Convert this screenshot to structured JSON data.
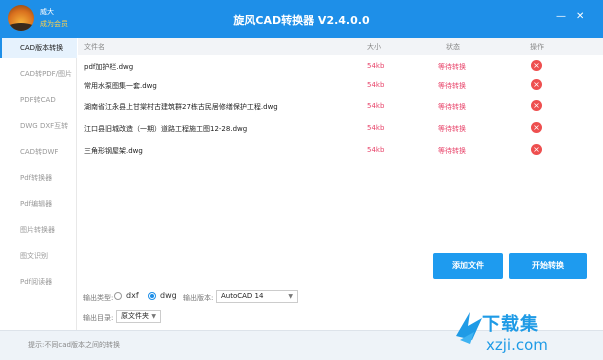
{
  "header": {
    "username": "威大",
    "member_label": "成为会员",
    "title": "旋风CAD转换器 V2.4.0.0",
    "minimize_glyph": "—",
    "close_glyph": "✕"
  },
  "sidebar": {
    "items": [
      {
        "label": "CAD版本转换",
        "active": true
      },
      {
        "label": "CAD转PDF/图片"
      },
      {
        "label": "PDF转CAD"
      },
      {
        "label": "DWG DXF互转"
      },
      {
        "label": "CAD转DWF"
      },
      {
        "label": "Pdf转换器"
      },
      {
        "label": "Pdf编辑器"
      },
      {
        "label": "图片转换器"
      },
      {
        "label": "图文识别"
      },
      {
        "label": "Pdf阅读器"
      }
    ]
  },
  "file_table": {
    "headers": {
      "name": "文件名",
      "size": "大小",
      "status": "状态",
      "action": "操作"
    },
    "rows": [
      {
        "name": "pdf加护栏.dwg",
        "size": "54kb",
        "status": "等待转换"
      },
      {
        "name": "常用水泵图集一套.dwg",
        "size": "54kb",
        "status": "等待转换"
      },
      {
        "name": "湖南省江永县上甘棠村古建筑群27栋古民居修缮保护工程.dwg",
        "size": "54kb",
        "status": "等待转换"
      },
      {
        "name": "江口县旧城改造（一期）道路工程施工图12-28.dwg",
        "size": "54kb",
        "status": "等待转换"
      },
      {
        "name": "三角形钢屋架.dwg",
        "size": "54kb",
        "status": "等待转换"
      }
    ]
  },
  "actions": {
    "add_file": "添加文件",
    "start_convert": "开始转换"
  },
  "options": {
    "output_type_label": "输出类型:",
    "types": [
      "dxf",
      "dwg"
    ],
    "selected_type": "dwg",
    "output_version_label": "输出版本:",
    "output_version_value": "AutoCAD 14",
    "output_dir_label": "输出目录:",
    "output_dir_value": "原文件夹"
  },
  "status_bar": {
    "hint": "提示:不同cad版本之间的转换"
  },
  "watermark": {
    "cn": "下载集",
    "url": "xzji.com"
  },
  "colors": {
    "accent": "#1e8fe8",
    "status_red": "#e8456b",
    "delete_red": "#ee4f4f"
  }
}
